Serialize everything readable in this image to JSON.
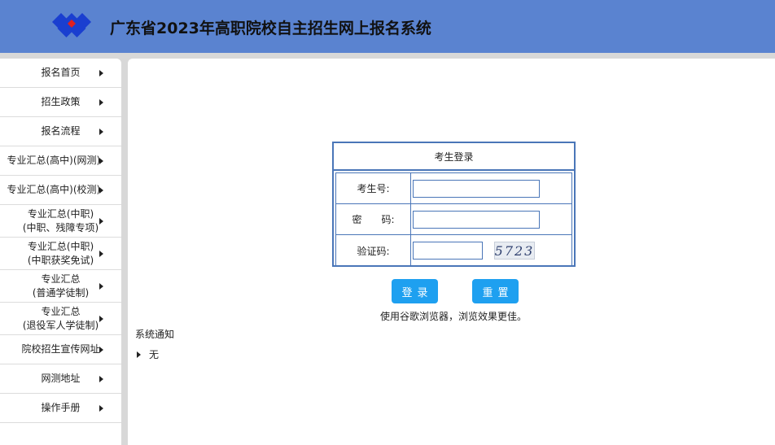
{
  "header": {
    "title": "广东省2023年高职院校自主招生网上报名系统",
    "logo_colors": [
      "#1a3fd0",
      "#e02020"
    ]
  },
  "sidebar": {
    "items": [
      {
        "label": "报名首页"
      },
      {
        "label": "招生政策"
      },
      {
        "label": "报名流程"
      },
      {
        "label": "专业汇总(高中)(网测)"
      },
      {
        "label": "专业汇总(高中)(校测)"
      },
      {
        "label_line1": "专业汇总(中职)",
        "label_line2": "(中职、残障专项)"
      },
      {
        "label_line1": "专业汇总(中职)",
        "label_line2": "(中职获奖免试)"
      },
      {
        "label_line1": "专业汇总",
        "label_line2": "(普通学徒制)"
      },
      {
        "label_line1": "专业汇总",
        "label_line2": "(退役军人学徒制)"
      },
      {
        "label": "院校招生宣传网址"
      },
      {
        "label": "网测地址"
      },
      {
        "label": "操作手册"
      }
    ]
  },
  "login": {
    "title": "考生登录",
    "exam_no_label": "考生号:",
    "exam_no_value": "",
    "password_label": "密　　码:",
    "password_value": "",
    "captcha_label": "验证码:",
    "captcha_value": "",
    "captcha_text": "5723",
    "login_button": "登录",
    "reset_button": "重置",
    "browser_hint": "使用谷歌浏览器，浏览效果更佳。"
  },
  "notice": {
    "title": "系统通知",
    "items": [
      "无"
    ]
  },
  "colors": {
    "header_bg": "#5a83d0",
    "border_blue": "#4a76b8",
    "button_blue": "#1ea0f0"
  }
}
